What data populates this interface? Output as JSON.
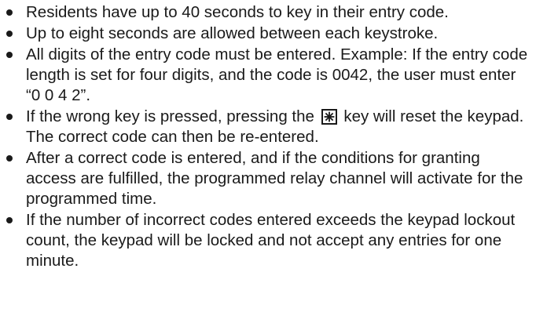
{
  "bullets": [
    {
      "text": "Residents have up to 40 seconds to key in their entry code."
    },
    {
      "text": "Up to eight seconds are allowed between each keystroke."
    },
    {
      "text": "All digits of the entry code must be entered. Example: If the entry code length is set for four digits, and the code is 0042, the user must enter “0 0 4 2”."
    },
    {
      "before": "If the wrong key is pressed, pressing the",
      "icon": "asterisk-key-icon",
      "after": "key will reset the keypad. The correct code can then be re-entered."
    },
    {
      "text": "After a correct code is entered, and if the conditions for granting access are fulfilled, the programmed relay channel will activate for the programmed time."
    },
    {
      "text": "If the number of incorrect codes entered exceeds the keypad lockout count, the keypad will be locked and not accept any entries for one minute."
    }
  ]
}
